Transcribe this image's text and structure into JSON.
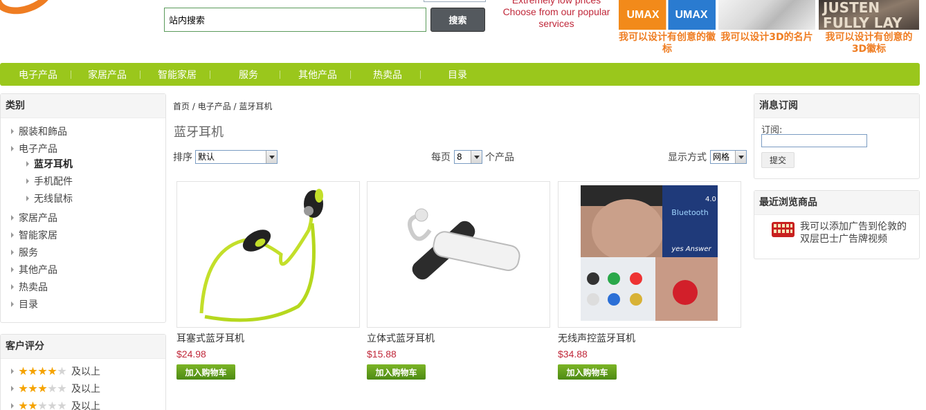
{
  "header": {
    "search_placeholder": "站内搜索",
    "search_button": "搜索",
    "promo_line1": "Extremely low prices",
    "promo_line2": "Choose from our popular services",
    "ads": [
      {
        "caption": "我可以设计有创意的徽标",
        "image": "umax-logo",
        "logo_text": "UMAX"
      },
      {
        "caption": "我可以设计3D的名片",
        "image": "3d-business-card"
      },
      {
        "caption": "我可以设计有创意的3D徽标",
        "image": "3d-logo",
        "art_text": "JUSTEN FULLY LAY"
      }
    ]
  },
  "nav": [
    "电子产品",
    "家居产品",
    "智能家居",
    "服务",
    "其他产品",
    "热卖品",
    "目录"
  ],
  "categories": {
    "title": "类别",
    "items": [
      "服装和飾品",
      "电子产品",
      "家居产品",
      "智能家居",
      "服务",
      "其他产品",
      "热卖品",
      "目录"
    ],
    "sub_items": [
      "蓝牙耳机",
      "手机配件",
      "无线鼠标"
    ]
  },
  "ratings": {
    "title": "客户评分",
    "suffix": "及以上",
    "levels": [
      4,
      3,
      2
    ]
  },
  "breadcrumb": [
    "首页",
    "电子产品",
    "蓝牙耳机"
  ],
  "page_title": "蓝牙耳机",
  "toolbar": {
    "sort_label": "排序",
    "sort_value": "默认",
    "per_page_label": "每页",
    "per_page_value": "8",
    "per_page_suffix": "个产品",
    "view_label": "显示方式",
    "view_value": "网格"
  },
  "products": [
    {
      "name": "耳塞式蓝牙耳机",
      "price": "$24.98",
      "image": "sport-earphones"
    },
    {
      "name": "立体式蓝牙耳机",
      "price": "$15.88",
      "image": "headset-earpiece"
    },
    {
      "name": "无线声控蓝牙耳机",
      "price": "$34.88",
      "image": "mini-earbud",
      "image_text": [
        "4.0",
        "Bluetooth",
        "yes Answer"
      ]
    }
  ],
  "cart_button": "加入购物车",
  "subscribe": {
    "title": "消息订阅",
    "label": "订阅:",
    "button": "提交"
  },
  "recent": {
    "title": "最近浏览商品",
    "item": "我可以添加广告到伦敦的双层巴士广告牌视频"
  },
  "colors": {
    "accent_green": "#9ac71c",
    "ad_orange": "#ef7d22",
    "price_red": "#c0283a"
  }
}
